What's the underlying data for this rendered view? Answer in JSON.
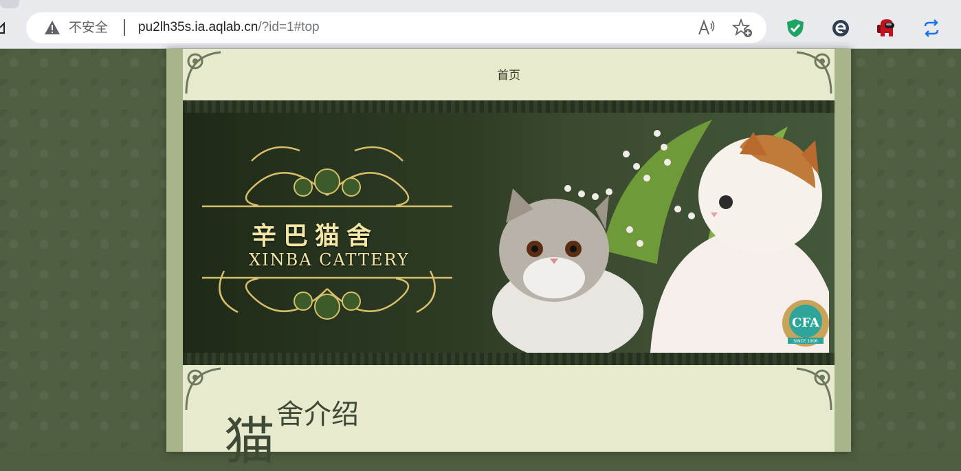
{
  "browser": {
    "security_label": "不安全",
    "url_host": "pu2lh35s.ia.aqlab.cn",
    "url_path": "/?id=1#top",
    "icons": [
      "home-icon",
      "warning-icon",
      "read-aloud-icon",
      "favorite-add-icon",
      "shield-extension-icon",
      "e-extension-icon",
      "among-us-extension-icon",
      "sync-extension-icon"
    ]
  },
  "site": {
    "nav": {
      "home": "首页"
    },
    "banner": {
      "logo_cn": "辛巴猫舍",
      "logo_en": "XINBA CATTERY",
      "badge_text": "CFA",
      "badge_since": "SINCE 1906"
    },
    "section": {
      "title_first": "猫",
      "title_rest": "舍介绍"
    }
  },
  "colors": {
    "page_bg": "#4f5f41",
    "panel_bg": "#e7eacd",
    "frame": "#a8b58a",
    "logo_gold": "#f3e6a6",
    "shield_green": "#1ea362",
    "sync_blue": "#1a73e8"
  }
}
